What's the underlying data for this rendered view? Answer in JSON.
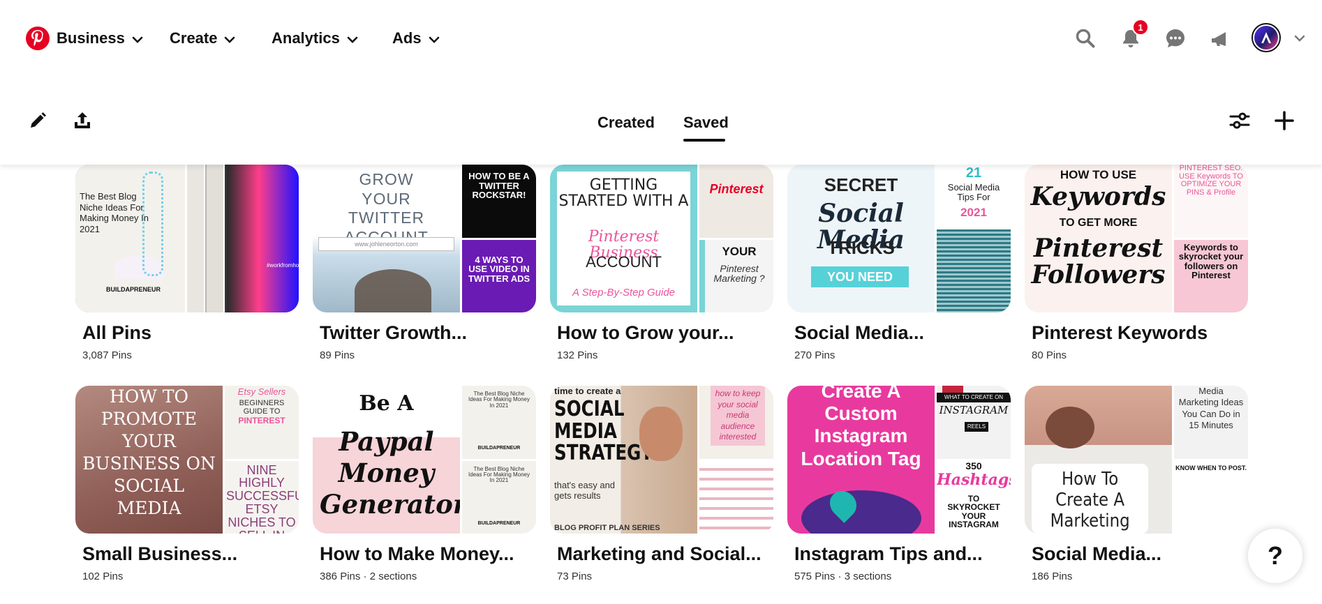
{
  "header": {
    "nav": [
      {
        "label": "Business"
      },
      {
        "label": "Create"
      },
      {
        "label": "Analytics"
      },
      {
        "label": "Ads"
      }
    ],
    "notification_count": "1"
  },
  "profile_bar": {
    "tabs": [
      {
        "label": "Created",
        "active": false
      },
      {
        "label": "Saved",
        "active": true
      }
    ]
  },
  "boards": [
    {
      "title": "All Pins",
      "meta": "3,087 Pins",
      "cover_text": {
        "main": "The Best Blog Niche Ideas For Making Money In 2021",
        "brand": "BUILDAPRENEUR",
        "tag": "#workfromhome"
      }
    },
    {
      "title": "Twitter Growth...",
      "meta": "89 Pins",
      "cover_text": {
        "main": "GROW YOUR TWITTER ACCOUNT",
        "url": "www.johleneorton.com",
        "top_right": "HOW TO BE A TWITTER ROCKSTAR!",
        "bottom_right": "4 WAYS TO USE VIDEO IN TWITTER ADS"
      }
    },
    {
      "title": "How to Grow your...",
      "meta": "132 Pins",
      "cover_text": {
        "main_1": "GETTING STARTED WITH A",
        "main_2": "Pinterest Business",
        "main_3": "ACCOUNT",
        "main_4": "A Step-By-Step Guide",
        "top_right": "Pinterest",
        "bottom_right_1": "YOUR",
        "bottom_right_2": "Pinterest Marketing ?"
      }
    },
    {
      "title": "Social Media...",
      "meta": "270 Pins",
      "cover_text": {
        "main_1": "SECRET",
        "main_2": "Social Media",
        "main_3": "TRICKS",
        "main_4": "YOU NEED",
        "right_1": "21",
        "right_2": "Social Media Tips For",
        "right_3": "2021"
      }
    },
    {
      "title": "Pinterest Keywords",
      "meta": "80 Pins",
      "cover_text": {
        "main_1": "HOW TO USE",
        "main_2": "Keywords",
        "main_3": "TO GET MORE",
        "main_4": "Pinterest Followers",
        "top_right": "PINTEREST SEO: USE Keywords TO OPTIMIZE YOUR PINS & Profile",
        "bottom_right": "Keywords to skyrocket your followers on Pinterest"
      }
    },
    {
      "title": "Small Business...",
      "meta": "102 Pins",
      "cover_text": {
        "main": "HOW TO PROMOTE YOUR BUSINESS ON SOCIAL MEDIA",
        "top_right_1": "Etsy Sellers",
        "top_right_2": "BEGINNERS GUIDE TO",
        "top_right_3": "PINTEREST",
        "bottom_right": "NINE HIGHLY SUCCESSFUL ETSY NICHES TO SELL IN"
      }
    },
    {
      "title": "How to Make Money...",
      "meta": "386 Pins · 2 sections",
      "cover_text": {
        "main_1": "Be A",
        "main_2": "Paypal Money Generator",
        "right": "The Best Blog Niche Ideas For Making Money In 2021",
        "brand": "BUILDAPRENEUR"
      }
    },
    {
      "title": "Marketing and Social...",
      "meta": "73 Pins",
      "cover_text": {
        "main_1": "time to create a",
        "main_2": "SOCIAL MEDIA STRATEGY",
        "main_3": "that's easy and gets results",
        "main_4": "BLOG PROFIT PLAN SERIES",
        "top_right": "how to keep your social media audience interested"
      }
    },
    {
      "title": "Instagram Tips and...",
      "meta": "575 Pins · 3 sections",
      "cover_text": {
        "main": "Create A Custom Instagram Location Tag",
        "top_right_1": "WHAT TO CREATE ON",
        "top_right_2": "INSTAGRAM",
        "top_right_3": "REELS",
        "bottom_right_1": "350",
        "bottom_right_2": "Hashtags",
        "bottom_right_3": "TO SKYROCKET YOUR INSTAGRAM"
      }
    },
    {
      "title": "Social Media...",
      "meta": "186 Pins",
      "cover_text": {
        "main": "How To Create A Marketing Plan For Your Business",
        "top_right": "Media Marketing Ideas You Can Do in 15 Minutes",
        "bottom_right": "KNOW WHEN TO POST."
      }
    }
  ],
  "help": {
    "label": "?"
  },
  "colors": {
    "brand": "#e60023",
    "text": "#111111"
  }
}
